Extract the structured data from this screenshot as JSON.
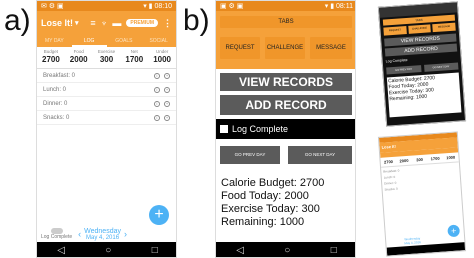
{
  "panels": {
    "a": "a)",
    "b": "b)"
  },
  "phone_a": {
    "status_time": "08:10",
    "app_title": "Lose It!",
    "pill": "PREMIUM",
    "tabs": [
      {
        "label": "MY DAY",
        "active": false
      },
      {
        "label": "LOG",
        "active": true
      },
      {
        "label": "GOALS",
        "active": false
      },
      {
        "label": "SOCIAL",
        "active": false
      }
    ],
    "summary": [
      {
        "label": "Budget",
        "value": "2700"
      },
      {
        "label": "Food",
        "value": "2000"
      },
      {
        "label": "Exercise",
        "value": "300"
      },
      {
        "label": "Net",
        "value": "1700"
      },
      {
        "label": "Under",
        "value": "1000"
      }
    ],
    "meals": [
      "Breakfast: 0",
      "Lunch: 0",
      "Dinner: 0",
      "Snacks: 0"
    ],
    "log_complete": "Log Complete",
    "day": "Wednesday",
    "date": "May 4, 2016"
  },
  "phone_b": {
    "status_time": "08:11",
    "tabs_header": "TABS",
    "buttons": [
      "REQUEST",
      "CHALLENGE",
      "MESSAGE"
    ],
    "view_records": "VIEW RECORDS",
    "add_record": "ADD RECORD",
    "log_complete": "Log Complete",
    "prev_day": "GO PREV DAY",
    "next_day": "GO NEXT DAY",
    "info": [
      "Calorie Budget: 2700",
      "Food Today: 2000",
      "Exercise Today: 300",
      "Remaining: 1000"
    ]
  },
  "mini_b": {
    "tabs_header": "TABS",
    "buttons": [
      "REQUEST",
      "CHALLENGE",
      "MESSAGE"
    ],
    "view_records": "VIEW RECORDS",
    "add_record": "ADD RECORD",
    "log_complete": "Log Complete",
    "prev_day": "GO PREV DAY",
    "next_day": "GO NEXT DAY",
    "info": [
      "Calorie Budget: 2700",
      "Food Today: 2000",
      "Exercise Today: 300",
      "Remaining: 1000"
    ]
  },
  "mini_a": {
    "app_title": "Lose It!",
    "summary": [
      "2700",
      "2000",
      "300",
      "1700",
      "1000"
    ],
    "meals": [
      "Breakfast: 0",
      "Lunch: 0",
      "Dinner: 0",
      "Snacks: 0"
    ],
    "day": "Wednesday",
    "date": "May 4, 2016"
  },
  "colors": {
    "orange": "#f5a13a",
    "orange_dark": "#e8891d",
    "grey_button": "#5b5b5b",
    "fab_blue": "#4db2f5"
  }
}
